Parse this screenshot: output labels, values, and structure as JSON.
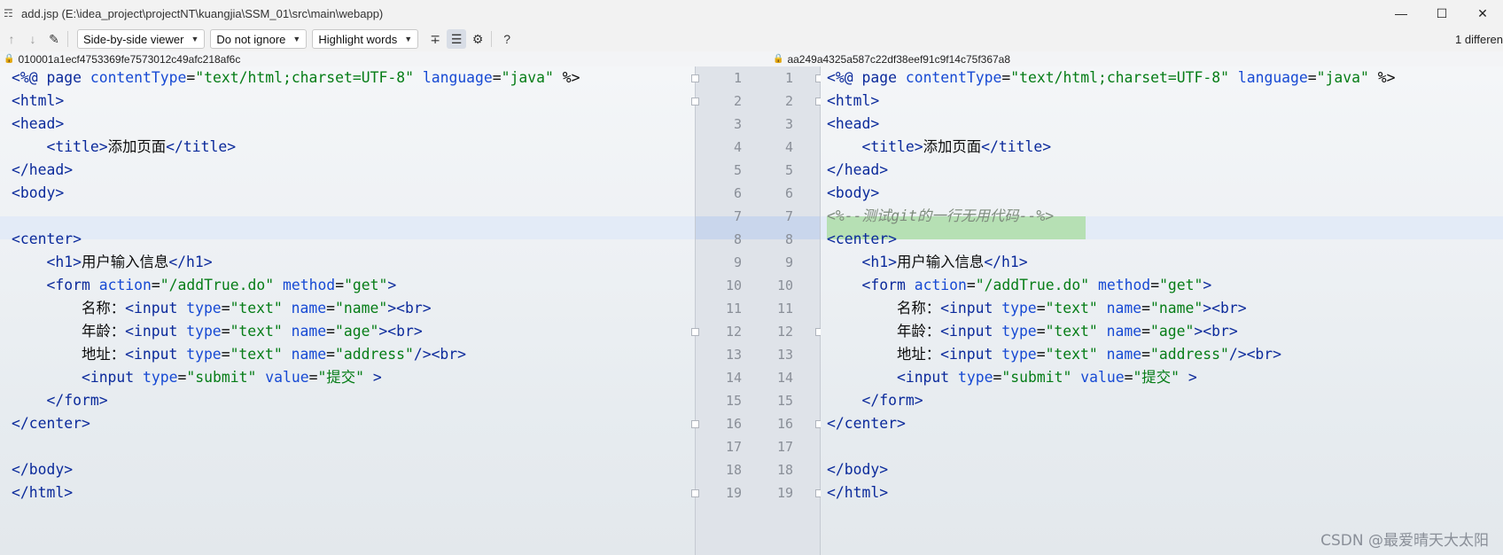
{
  "window": {
    "title": "add.jsp (E:\\idea_project\\projectNT\\kuangjia\\SSM_01\\src\\main\\webapp)",
    "minimize_icon": "minimize-icon",
    "maximize_icon": "maximize-icon",
    "close_icon": "close-icon"
  },
  "toolbar": {
    "viewer_select": "Side-by-side viewer",
    "ignore_select": "Do not ignore",
    "highlight_select": "Highlight words",
    "help": "?",
    "differences_count": "1 differen",
    "icons": [
      "arrow-up-icon",
      "arrow-down-icon",
      "edit-icon",
      "collapse-icon",
      "sync-scroll-icon",
      "settings-icon",
      "help-icon"
    ]
  },
  "left": {
    "revision": "010001a1ecf4753369fe7573012c49afc218af6c"
  },
  "right": {
    "revision": "aa249a4325a587c22df38eef91c9f14c75f367a8"
  },
  "line_numbers": [
    "1",
    "2",
    "3",
    "4",
    "5",
    "6",
    "7",
    "8",
    "9",
    "10",
    "11",
    "12",
    "13",
    "14",
    "15",
    "16",
    "17",
    "18",
    "19"
  ],
  "code": {
    "l1": {
      "a": "<%@ ",
      "b": "page ",
      "c": "contentType",
      "d": "=",
      "e": "\"text/html;charset=UTF-8\"",
      "f": " ",
      "g": "language",
      "h": "=",
      "i": "\"java\"",
      "j": " %>"
    },
    "l2": "<html>",
    "l3": "<head>",
    "l4": {
      "indent": "    ",
      "open": "<title>",
      "text": "添加页面",
      "close": "</title>"
    },
    "l5": "</head>",
    "l6": "<body>",
    "l7_right": "<%--测试git的一行无用代码--%>",
    "l8": "<center>",
    "l9": {
      "indent": "    ",
      "open": "<h1>",
      "text": "用户输入信息",
      "close": "</h1>"
    },
    "l10": {
      "indent": "    ",
      "tag": "<form ",
      "a1": "action",
      "eq1": "=",
      "v1": "\"/addTrue.do\"",
      "sp": " ",
      "a2": "method",
      "eq2": "=",
      "v2": "\"get\"",
      "end": ">"
    },
    "l11": {
      "indent": "        ",
      "label": "名称：",
      "tag": "<input ",
      "a1": "type",
      "eq1": "=",
      "v1": "\"text\"",
      "sp": " ",
      "a2": "name",
      "eq2": "=",
      "v2": "\"name\"",
      "end": "><br>"
    },
    "l12": {
      "indent": "        ",
      "label": "年龄：",
      "tag": "<input ",
      "a1": "type",
      "eq1": "=",
      "v1": "\"text\"",
      "sp": " ",
      "a2": "name",
      "eq2": "=",
      "v2": "\"age\"",
      "end": "><br>"
    },
    "l13": {
      "indent": "        ",
      "label": "地址：",
      "tag": "<input ",
      "a1": "type",
      "eq1": "=",
      "v1": "\"text\"",
      "sp": " ",
      "a2": "name",
      "eq2": "=",
      "v2": "\"address\"",
      "end": "/><br>"
    },
    "l14": {
      "indent": "        ",
      "tag": "<input ",
      "a1": "type",
      "eq1": "=",
      "v1": "\"submit\"",
      "sp": " ",
      "a2": "value",
      "eq2": "=",
      "v2": "\"提交\"",
      "end": " >"
    },
    "l15": {
      "indent": "    ",
      "text": "</form>"
    },
    "l16": "</center>",
    "l18": "</body>",
    "l19": "</html>"
  },
  "watermark": "CSDN @最爱晴天大太阳"
}
